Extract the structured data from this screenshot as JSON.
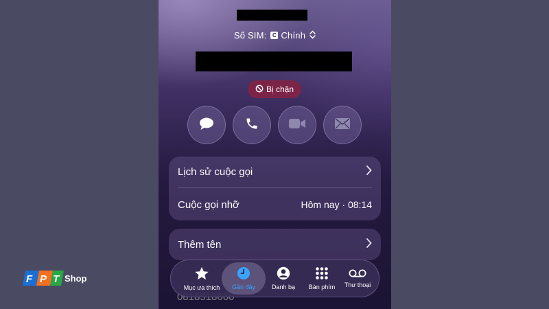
{
  "header": {
    "sim_label": "Số SIM:",
    "sim_badge": "C",
    "sim_value": "Chính"
  },
  "status": {
    "blocked_label": "Bị chặn"
  },
  "actions": [
    {
      "icon": "message-icon"
    },
    {
      "icon": "phone-icon"
    },
    {
      "icon": "video-icon"
    },
    {
      "icon": "mail-icon"
    }
  ],
  "details": {
    "history_label": "Lịch sử cuộc gọi",
    "missed_label": "Cuộc gọi nhỡ",
    "missed_time": "Hôm nay · 08:14",
    "add_name_label": "Thêm tên",
    "partial_number": "0818518660"
  },
  "tabbar": {
    "tabs": [
      {
        "label": "Mục ưa thích",
        "icon": "star-icon"
      },
      {
        "label": "Gần đây",
        "icon": "clock-icon",
        "active": true
      },
      {
        "label": "Danh bạ",
        "icon": "contact-icon"
      },
      {
        "label": "Bàn phím",
        "icon": "keypad-icon"
      },
      {
        "label": "Thư thoại",
        "icon": "voicemail-icon"
      }
    ]
  },
  "watermark": {
    "brand": "FPT",
    "suffix": "Shop"
  },
  "colors": {
    "background": "#4a4a63",
    "blocked_badge": "#7c2447",
    "active_tab": "#3aa2ff",
    "fpt_blue": "#1b6fd1",
    "fpt_orange": "#f37021",
    "fpt_green": "#27a844"
  }
}
